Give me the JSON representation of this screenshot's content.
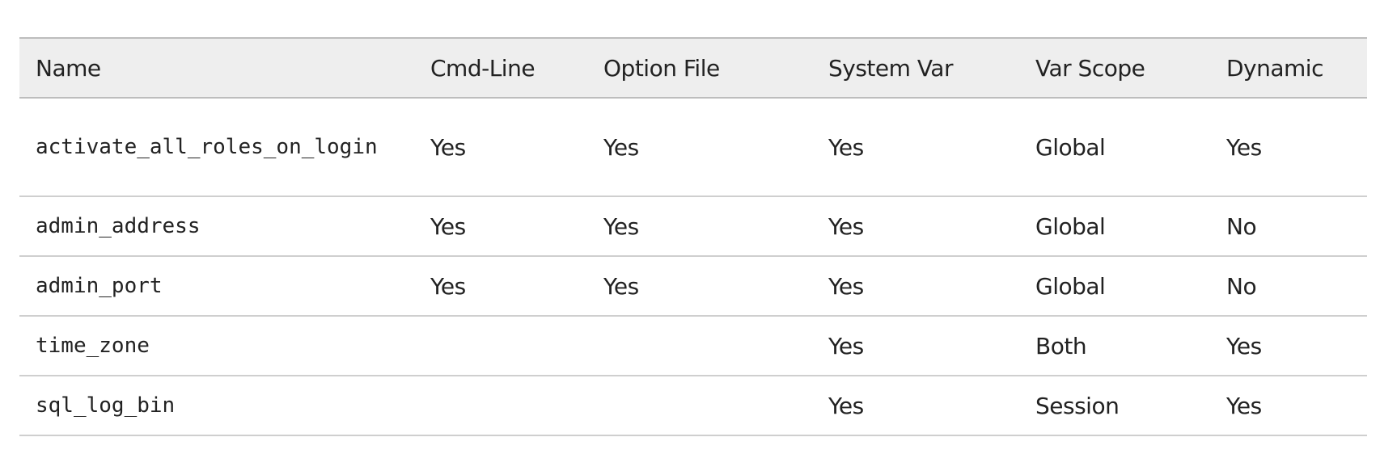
{
  "table": {
    "headers": [
      "Name",
      "Cmd-Line",
      "Option File",
      "System Var",
      "Var Scope",
      "Dynamic"
    ],
    "rows": [
      {
        "name": "activate_all_roles_on_login",
        "cmd_line": "Yes",
        "option_file": "Yes",
        "system_var": "Yes",
        "var_scope": "Global",
        "dynamic": "Yes"
      },
      {
        "name": "admin_address",
        "cmd_line": "Yes",
        "option_file": "Yes",
        "system_var": "Yes",
        "var_scope": "Global",
        "dynamic": "No"
      },
      {
        "name": "admin_port",
        "cmd_line": "Yes",
        "option_file": "Yes",
        "system_var": "Yes",
        "var_scope": "Global",
        "dynamic": "No"
      },
      {
        "name": "time_zone",
        "cmd_line": "",
        "option_file": "",
        "system_var": "Yes",
        "var_scope": "Both",
        "dynamic": "Yes"
      },
      {
        "name": "sql_log_bin",
        "cmd_line": "",
        "option_file": "",
        "system_var": "Yes",
        "var_scope": "Session",
        "dynamic": "Yes"
      }
    ]
  }
}
